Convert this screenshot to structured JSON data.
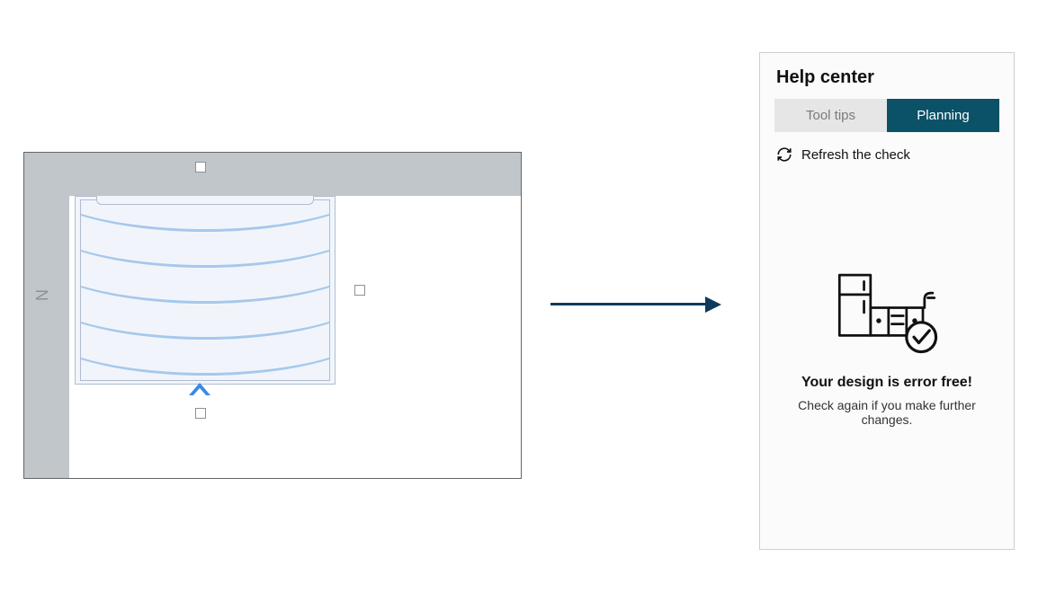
{
  "canvas": {
    "compass_label": "N"
  },
  "help_center": {
    "title": "Help center",
    "tabs": {
      "tool_tips": "Tool tips",
      "planning": "Planning"
    },
    "refresh_label": "Refresh the check",
    "status_heading": "Your design is error free!",
    "status_sub": "Check again if you make further changes."
  }
}
